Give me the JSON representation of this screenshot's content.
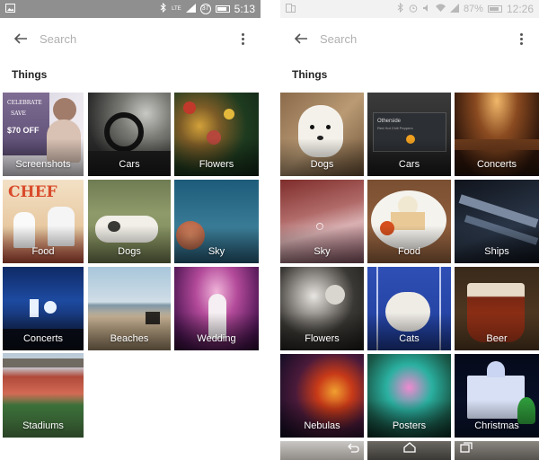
{
  "left_phone": {
    "status": {
      "time": "5:13",
      "badge": "37",
      "lte": "LTE"
    },
    "search": {
      "placeholder": "Search"
    },
    "section_title": "Things",
    "tiles": [
      {
        "label": "Screenshots",
        "ad_text_1": "CELEBRATE",
        "ad_text_2": "SAVE",
        "ad_price": "$70 OFF"
      },
      {
        "label": "Cars"
      },
      {
        "label": "Flowers"
      },
      {
        "label": "Food",
        "sign_text": "CHEF"
      },
      {
        "label": "Dogs"
      },
      {
        "label": "Sky"
      },
      {
        "label": "Concerts"
      },
      {
        "label": "Beaches"
      },
      {
        "label": "Wedding"
      },
      {
        "label": "Stadiums"
      }
    ]
  },
  "right_phone": {
    "status": {
      "time": "12:26",
      "battery": "87%"
    },
    "search": {
      "placeholder": "Search"
    },
    "section_title": "Things",
    "tiles": [
      {
        "label": "Dogs"
      },
      {
        "label": "Cars",
        "screen_title": "Otherside",
        "screen_subtitle": "Red Hot Chili Peppers"
      },
      {
        "label": "Concerts"
      },
      {
        "label": "Sky"
      },
      {
        "label": "Food"
      },
      {
        "label": "Ships"
      },
      {
        "label": "Flowers"
      },
      {
        "label": "Cats"
      },
      {
        "label": "Beer"
      },
      {
        "label": "Nebulas"
      },
      {
        "label": "Posters"
      },
      {
        "label": "Christmas"
      }
    ]
  },
  "colors": {
    "left_status_bg": "#8f8f8f",
    "right_status_bg": "#f2f2f2",
    "label_text": "#ffffff"
  }
}
